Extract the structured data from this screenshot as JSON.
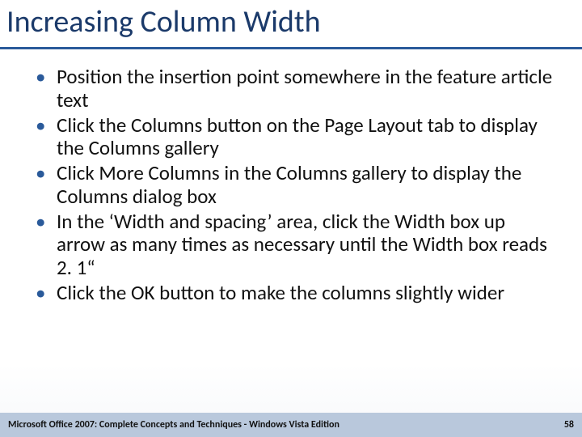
{
  "title": "Increasing Column Width",
  "bullets": [
    "Position the insertion point somewhere in the feature article text",
    "Click the Columns button on the Page Layout tab to display the Columns gallery",
    "Click More Columns in the Columns gallery to display the Columns dialog box",
    "In the ‘Width and spacing’ area, click the Width box up arrow as many times as necessary until the Width box reads 2. 1“",
    "Click the OK button to make the columns slightly wider"
  ],
  "footer": {
    "source": "Microsoft Office 2007: Complete Concepts and Techniques - Windows Vista Edition",
    "page": "58"
  },
  "colors": {
    "title": "#1b3a6a",
    "rule": "#2a5a9a",
    "bullet": "#2a5a9a",
    "footer_bg": "#b9c8dc"
  }
}
